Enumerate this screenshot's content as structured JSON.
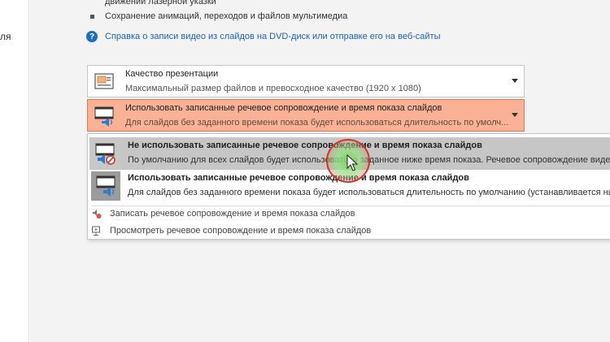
{
  "left_strip": {
    "text": "ля"
  },
  "top_partial": "движении лазерной указки",
  "bullet_item": "Сохранение анимаций, переходов и файлов мультимедиа",
  "help": {
    "icon": "?",
    "link": "Справка о записи видео из слайдов на DVD-диск или отправке его на веб-сайты"
  },
  "quality_dropdown": {
    "icon": "presentation-quality-icon",
    "title": "Качество презентации",
    "subtitle": "Максимальный размер файлов и превосходное качество (1920 x 1080)"
  },
  "narration_dropdown": {
    "icon": "narration-timing-icon",
    "title": "Использовать записанные речевое сопровождение и время показа слайдов",
    "subtitle": "Для слайдов без заданного времени показа будет использоваться длительность по умолч...",
    "highlight_color": "#f9b296"
  },
  "menu": {
    "options": [
      {
        "title": "Не использовать записанные речевое сопровождение и время показа слайдов",
        "subtitle": "По умолчанию для всех слайдов будет использоваться заданное ниже время показа. Речевое сопровождение видеозаписи"
      },
      {
        "title": "Использовать записанные речевое сопровождение и время показа слайдов",
        "subtitle": "Для слайдов без заданного времени показа будет использоваться длительность по умолчанию (устанавливается ниже). Эт"
      }
    ],
    "commands": [
      {
        "label": "Записать речевое сопровождение и время показа слайдов",
        "icon": "record-narration-icon"
      },
      {
        "label": "Просмотреть речевое сопровождение и время показа слайдов",
        "icon": "preview-narration-icon"
      }
    ]
  }
}
